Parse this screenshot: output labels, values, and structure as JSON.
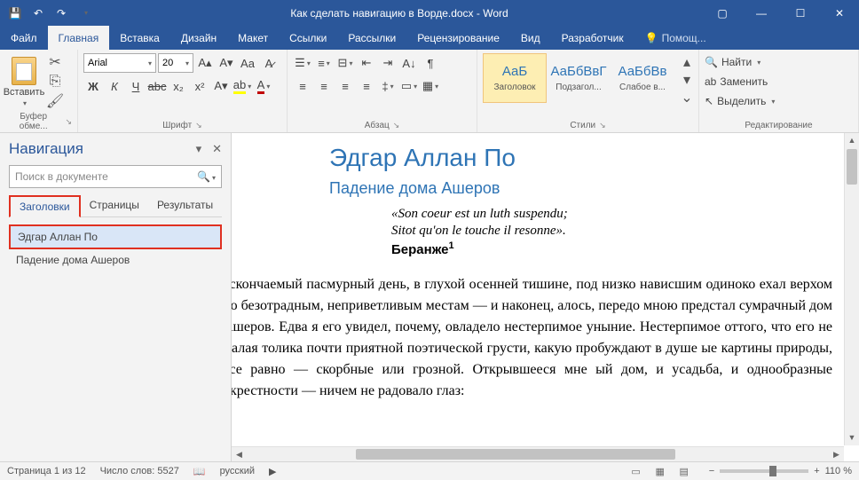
{
  "title": "Как сделать навигацию в Ворде.docx - Word",
  "tabs": {
    "file": "Файл",
    "home": "Главная",
    "insert": "Вставка",
    "design": "Дизайн",
    "layout": "Макет",
    "references": "Ссылки",
    "mailings": "Рассылки",
    "review": "Рецензирование",
    "view": "Вид",
    "developer": "Разработчик",
    "tell": "Помощ..."
  },
  "ribbon": {
    "clipboard": {
      "label": "Буфер обме...",
      "paste": "Вставить"
    },
    "font": {
      "label": "Шрифт",
      "name": "Arial",
      "size": "20",
      "bold": "Ж",
      "italic": "К",
      "underline": "Ч",
      "strike": "abc",
      "sub": "x₂",
      "sup": "x²",
      "case": "Aa",
      "clear": "⌫"
    },
    "paragraph": {
      "label": "Абзац"
    },
    "styles": {
      "label": "Стили",
      "items": [
        {
          "preview": "АаБ",
          "name": "Заголовок"
        },
        {
          "preview": "АаБбВвГ",
          "name": "Подзагол..."
        },
        {
          "preview": "АаБбВв",
          "name": "Слабое в..."
        }
      ]
    },
    "editing": {
      "label": "Редактирование",
      "find": "Найти",
      "replace": "Заменить",
      "select": "Выделить"
    }
  },
  "navpane": {
    "title": "Навигация",
    "search_placeholder": "Поиск в документе",
    "tabs": {
      "headings": "Заголовки",
      "pages": "Страницы",
      "results": "Результаты"
    },
    "items": [
      "Эдгар Аллан По",
      "Падение дома Ашеров"
    ]
  },
  "document": {
    "title": "Эдгар Аллан По",
    "subtitle": "Падение дома Ашеров",
    "epigraph1": "«Son coeur est un luth suspendu;",
    "epigraph2": "Sitot qu'on le touche il resonne».",
    "author": "Беранже",
    "footnote": "1",
    "body": "ескончаемый пасмурный день, в глухой осенней тишине, под низко нависшим одиноко ехал верхом по безотрадным, неприветливым местам — и наконец, алось, передо мною предстал сумрачный дом Ашеров. Едва я его увидел, почему, овладело нестерпимое уныние. Нестерпимое оттого, что его не малая толика почти приятной поэтической грусти, какую пробуждают в душе ые картины природы, все равно — скорбные или грозной. Открывшееся мне ый дом, и усадьба, и однообразные окрестности — ничем не радовало глаз:"
  },
  "status": {
    "page": "Страница 1 из 12",
    "words": "Число слов: 5527",
    "lang": "русский",
    "zoom": "110 %"
  }
}
